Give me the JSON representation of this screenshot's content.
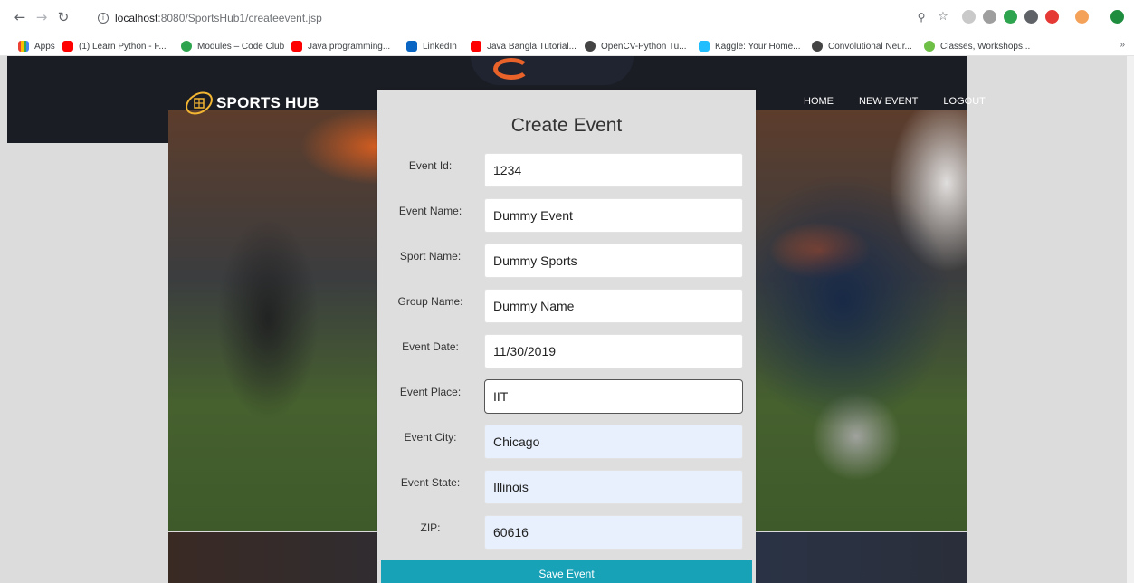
{
  "browser": {
    "back_icon": "arrow-left-icon",
    "forward_icon": "arrow-right-icon",
    "reload_icon": "reload-icon",
    "url_host": "localhost",
    "url_path": ":8080/SportsHub1/createevent.jsp",
    "bookmarks": [
      {
        "label": "Apps",
        "color": "#ea4335"
      },
      {
        "label": "(1) Learn Python - F...",
        "color": "#ff0000"
      },
      {
        "label": "Modules – Code Club",
        "color": "#2ea44f"
      },
      {
        "label": "Java programming...",
        "color": "#ff0000"
      },
      {
        "label": "LinkedIn",
        "color": "#0a66c2"
      },
      {
        "label": "Java Bangla Tutorial...",
        "color": "#ff0000"
      },
      {
        "label": "OpenCV-Python Tu...",
        "color": "#444444"
      },
      {
        "label": "Kaggle: Your Home...",
        "color": "#20beff"
      },
      {
        "label": "Convolutional Neur...",
        "color": "#444444"
      },
      {
        "label": "Classes, Workshops...",
        "color": "#6dbf45"
      }
    ],
    "more_bookmarks": "»"
  },
  "site": {
    "brand": "SPORTS HUB",
    "nav": [
      "HOME",
      "NEW EVENT",
      "LOGOUT"
    ]
  },
  "form": {
    "title": "Create Event",
    "fields": [
      {
        "label": "Event Id:",
        "value": "1234"
      },
      {
        "label": "Event Name:",
        "value": "Dummy Event"
      },
      {
        "label": "Sport Name:",
        "value": "Dummy Sports"
      },
      {
        "label": "Group Name:",
        "value": "Dummy Name"
      },
      {
        "label": "Event Date:",
        "value": "11/30/2019"
      },
      {
        "label": "Event Place:",
        "value": "IIT"
      },
      {
        "label": "Event City:",
        "value": "Chicago"
      },
      {
        "label": "Event State:",
        "value": "Illinois"
      },
      {
        "label": "ZIP:",
        "value": "60616"
      }
    ],
    "submit_label": "Save Event",
    "accent_color": "#17a2b8"
  }
}
